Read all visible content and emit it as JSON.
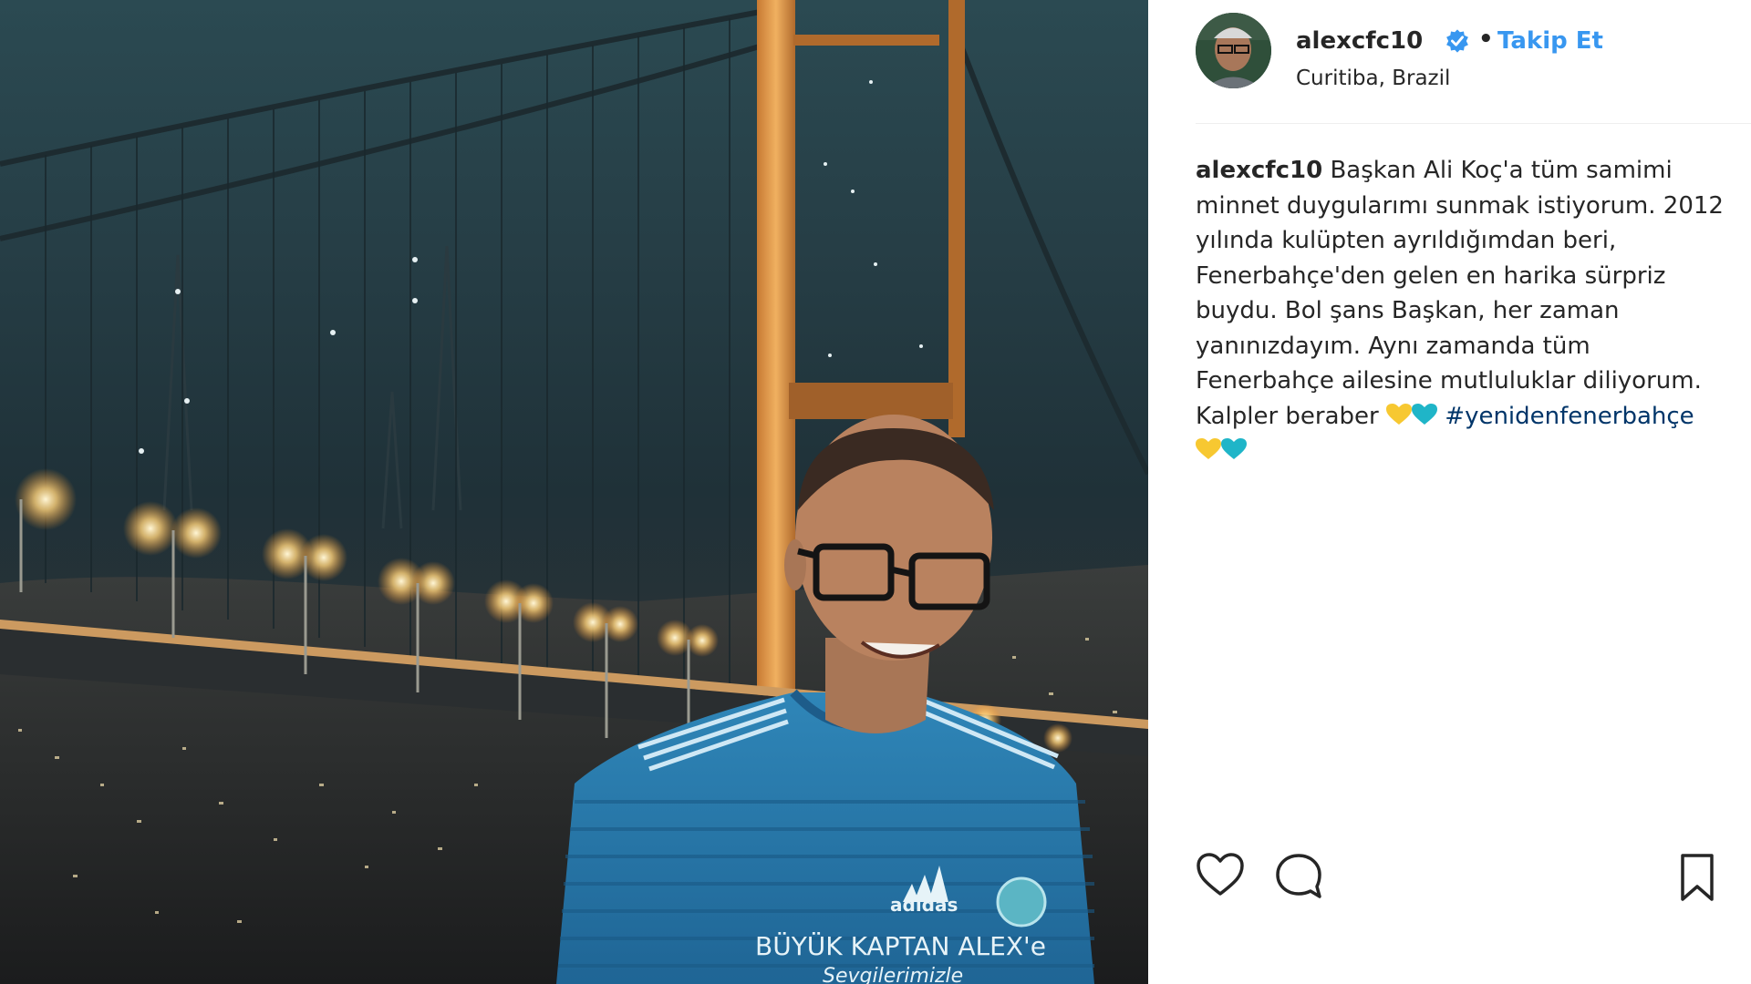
{
  "header": {
    "username": "alexcfc10",
    "separator": "•",
    "follow_label": "Takip Et",
    "location": "Curitiba, Brazil",
    "avatar_icon": "profile-avatar",
    "verified_icon": "verified-badge-icon"
  },
  "caption": {
    "username": "alexcfc10",
    "text": " Başkan Ali Koç'a tüm samimi minnet duygularımı sunmak istiyorum. 2012 yılında kulüpten ayrıldığımdan beri, Fenerbahçe'den gelen en harika sürpriz buydu. Bol şans Başkan, her zaman yanınızdayım. Aynı zamanda tüm Fenerbahçe ailesine mutluluklar diliyorum. Kalpler beraber ",
    "hashtag": "#yenidenfenerbahçe",
    "emoji": [
      "yellow-heart",
      "blue-heart",
      "yellow-heart",
      "blue-heart"
    ]
  },
  "photo": {
    "jersey_text_line1": "BÜYÜK KAPTAN ALEX'e",
    "jersey_text_line2": "Sevgilerimizle",
    "brand": "adidas"
  },
  "actions": {
    "like_icon": "heart-outline-icon",
    "comment_icon": "comment-bubble-icon",
    "save_icon": "bookmark-icon"
  },
  "colors": {
    "link_blue": "#3897f0",
    "hashtag_blue": "#003569",
    "verified_blue": "#3897f0",
    "heart_yellow": "#f7c831",
    "heart_teal": "#1fb5c8"
  }
}
